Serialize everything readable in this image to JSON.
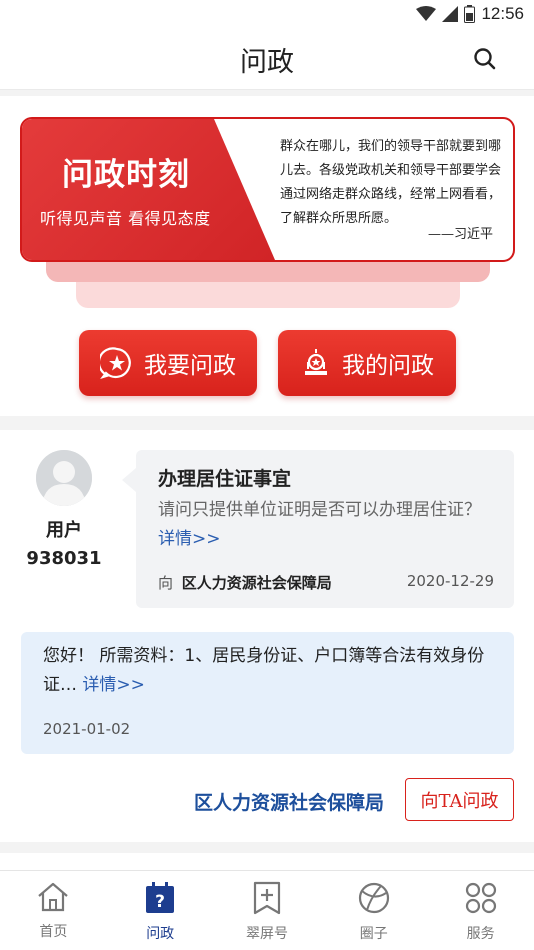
{
  "status_bar": {
    "time": "12:56"
  },
  "header": {
    "title": "问政"
  },
  "banner": {
    "title": "问政时刻",
    "slogan": "听得见声音 看得见态度",
    "quote": "群众在哪儿，我们的领导干部就要到哪儿去。各级党政机关和领导干部要学会通过网络走群众路线，经常上网看看，了解群众所思所愿。",
    "author": "——习近平"
  },
  "actions": {
    "ask_label": "我要问政",
    "mine_label": "我的问政"
  },
  "post": {
    "user_name": "用户",
    "user_id": "938031",
    "title": "办理居住证事宜",
    "body": "请问只提供单位证明是否可以办理居住证？",
    "detail_link": "详情>>",
    "to_label": "向",
    "department": "区人力资源社会保障局",
    "date": "2020-12-29",
    "reply_body": "您好！ 所需资料：1、居民身份证、户口簿等合法有效身份证…",
    "reply_detail_link": "详情>>",
    "reply_date": "2021-01-02",
    "footer_department": "区人力资源社会保障局",
    "ask_ta_label": "向TA问政"
  },
  "colors": {
    "accent_red": "#d8221c",
    "nav_active": "#1d3d8f",
    "dept_blue": "#1d4f9c"
  },
  "bottom_nav": [
    {
      "label": "首页",
      "icon": "home-icon",
      "active": false
    },
    {
      "label": "问政",
      "icon": "question-calendar-icon",
      "active": true
    },
    {
      "label": "翠屏号",
      "icon": "bookmark-plus-icon",
      "active": false
    },
    {
      "label": "圈子",
      "icon": "circle-globe-icon",
      "active": false
    },
    {
      "label": "服务",
      "icon": "grid-clover-icon",
      "active": false
    }
  ]
}
